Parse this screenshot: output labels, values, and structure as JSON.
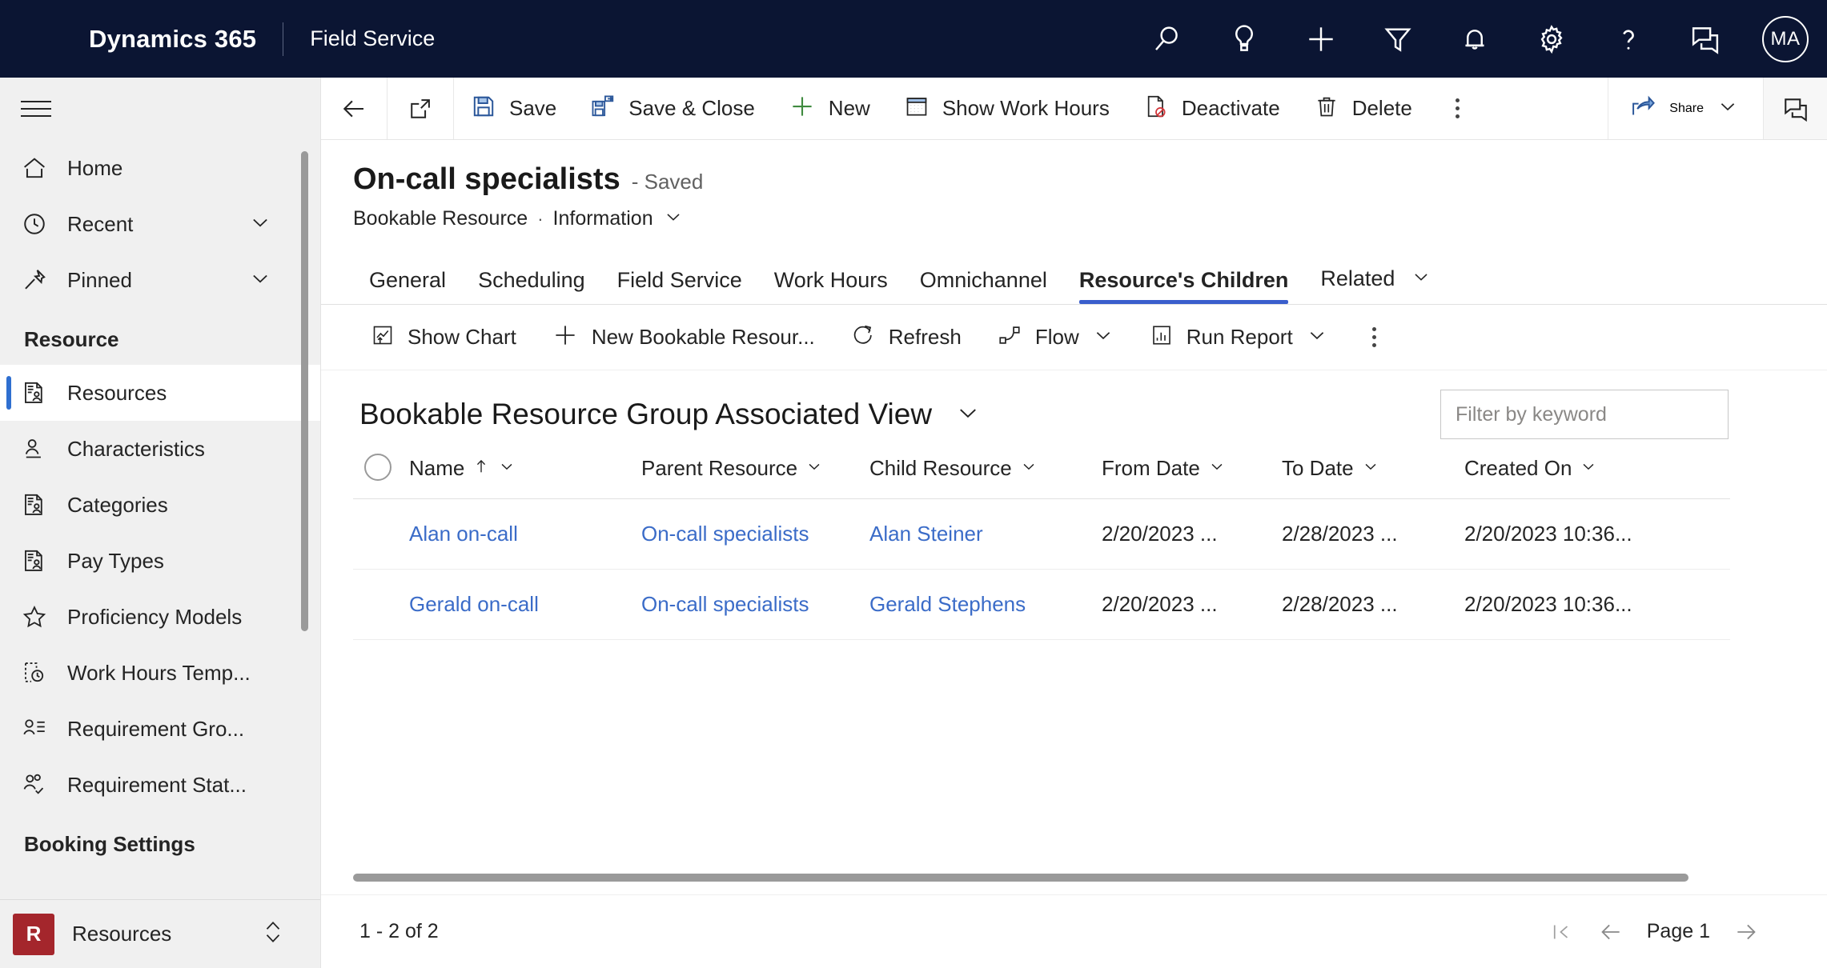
{
  "header": {
    "brand": "Dynamics 365",
    "app_name": "Field Service",
    "icons": [
      {
        "name": "search-icon",
        "label": "Search"
      },
      {
        "name": "insights-lightbulb-icon",
        "label": "Insights"
      },
      {
        "name": "quick-create-plus-icon",
        "label": "Quick Create"
      },
      {
        "name": "filter-icon",
        "label": "Filter"
      },
      {
        "name": "notifications-bell-icon",
        "label": "Notifications"
      },
      {
        "name": "settings-gear-icon",
        "label": "Settings"
      },
      {
        "name": "help-question-icon",
        "label": "Help"
      },
      {
        "name": "feedback-chat-icon",
        "label": "Feedback"
      }
    ],
    "avatar_initials": "MA"
  },
  "sidebar": {
    "top_items": [
      {
        "label": "Home",
        "icon": "home-icon",
        "chevron": false
      },
      {
        "label": "Recent",
        "icon": "clock-icon",
        "chevron": true
      },
      {
        "label": "Pinned",
        "icon": "pin-icon",
        "chevron": true
      }
    ],
    "group_label": "Resource",
    "items": [
      {
        "label": "Resources",
        "icon": "resource-card-icon",
        "selected": true
      },
      {
        "label": "Characteristics",
        "icon": "person-line-icon",
        "selected": false
      },
      {
        "label": "Categories",
        "icon": "resource-card-icon",
        "selected": false
      },
      {
        "label": "Pay Types",
        "icon": "resource-card-icon",
        "selected": false
      },
      {
        "label": "Proficiency Models",
        "icon": "star-icon",
        "selected": false
      },
      {
        "label": "Work Hours Temp...",
        "icon": "work-hours-clock-icon",
        "selected": false
      },
      {
        "label": "Requirement Gro...",
        "icon": "person-list-icon",
        "selected": false
      },
      {
        "label": "Requirement Stat...",
        "icon": "people-check-icon",
        "selected": false
      }
    ],
    "footer_group_label": "Booking Settings",
    "area_switcher": {
      "badge": "R",
      "label": "Resources",
      "icon": "updown-chevron-icon"
    }
  },
  "command_bar": {
    "back_icon": "back-arrow-icon",
    "popout_icon": "pop-out-icon",
    "buttons": [
      {
        "label": "Save",
        "icon": "save-floppy-icon"
      },
      {
        "label": "Save & Close",
        "icon": "save-and-close-icon"
      },
      {
        "label": "New",
        "icon": "plus-icon"
      },
      {
        "label": "Show Work Hours",
        "icon": "calendar-icon"
      },
      {
        "label": "Deactivate",
        "icon": "deactivate-icon"
      },
      {
        "label": "Delete",
        "icon": "trash-icon"
      }
    ],
    "overflow_icon": "more-vertical-icon",
    "share_label": "Share",
    "share_icon": "share-arrow-icon",
    "share_chevron": "chevron-down-icon",
    "chat_icon": "chat-bubbles-icon"
  },
  "record": {
    "title": "On-call specialists",
    "status": "- Saved",
    "entity": "Bookable Resource",
    "separator": "·",
    "form": "Information",
    "form_chevron": "chevron-down-icon"
  },
  "tabs": [
    {
      "label": "General",
      "active": false
    },
    {
      "label": "Scheduling",
      "active": false
    },
    {
      "label": "Field Service",
      "active": false
    },
    {
      "label": "Work Hours",
      "active": false
    },
    {
      "label": "Omnichannel",
      "active": false
    },
    {
      "label": "Resource's Children",
      "active": true
    },
    {
      "label": "Related",
      "active": false,
      "chevron": "chevron-down-icon"
    }
  ],
  "subgrid": {
    "commands": [
      {
        "label": "Show Chart",
        "icon": "show-chart-icon"
      },
      {
        "label": "New Bookable Resour...",
        "icon": "plus-icon"
      },
      {
        "label": "Refresh",
        "icon": "refresh-icon"
      },
      {
        "label": "Flow",
        "icon": "flow-icon",
        "chevron": "chevron-down-icon"
      },
      {
        "label": "Run Report",
        "icon": "report-icon",
        "chevron": "chevron-down-icon"
      }
    ],
    "overflow_icon": "more-vertical-icon",
    "view_title": "Bookable Resource Group Associated View",
    "view_chevron": "chevron-down-icon",
    "search": {
      "placeholder": "Filter by keyword",
      "value": ""
    },
    "columns": [
      {
        "label": "Name",
        "sort": "ascending",
        "sort_icon": "arrow-up-icon",
        "chevron": "chevron-down-icon"
      },
      {
        "label": "Parent Resource",
        "chevron": "chevron-down-icon"
      },
      {
        "label": "Child Resource",
        "chevron": "chevron-down-icon"
      },
      {
        "label": "From Date",
        "chevron": "chevron-down-icon"
      },
      {
        "label": "To Date",
        "chevron": "chevron-down-icon"
      },
      {
        "label": "Created On",
        "chevron": "chevron-down-icon"
      }
    ],
    "rows": [
      {
        "name": "Alan on-call",
        "parent_resource": "On-call specialists",
        "child_resource": "Alan Steiner",
        "from_date": "2/20/2023 ...",
        "to_date": "2/28/2023 ...",
        "created_on": "2/20/2023 10:36..."
      },
      {
        "name": "Gerald on-call",
        "parent_resource": "On-call specialists",
        "child_resource": "Gerald Stephens",
        "from_date": "2/20/2023 ...",
        "to_date": "2/28/2023 ...",
        "created_on": "2/20/2023 10:36..."
      }
    ],
    "pager": {
      "count_text": "1 - 2 of 2",
      "first_icon": "page-first-icon",
      "prev_icon": "page-prev-icon",
      "page_label": "Page 1",
      "next_icon": "page-next-icon"
    }
  },
  "colors": {
    "header_bg": "#0b1533",
    "accent_blue": "#3a5ecc",
    "link_blue": "#3b6cc8",
    "sidebar_bg": "#f0f0f0",
    "badge_red": "#a4262c"
  }
}
